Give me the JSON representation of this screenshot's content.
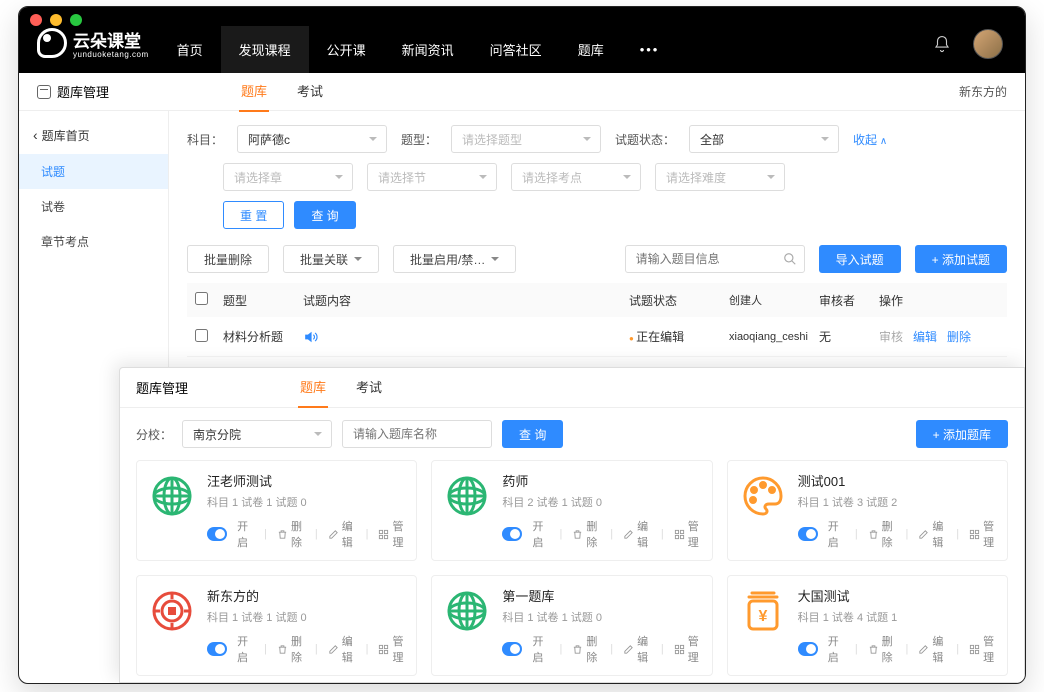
{
  "logo": {
    "name": "云朵课堂",
    "sub": "yunduoketang.com"
  },
  "nav": {
    "items": [
      "首页",
      "发现课程",
      "公开课",
      "新闻资讯",
      "问答社区",
      "题库"
    ],
    "active": 1
  },
  "crumb": "题库管理",
  "owner": "新东方的",
  "tabs": {
    "items": [
      "题库",
      "考试"
    ],
    "active": 0
  },
  "sidebar": {
    "back": "题库首页",
    "items": [
      "试题",
      "试卷",
      "章节考点"
    ],
    "active": 0
  },
  "filters": {
    "subject_label": "科目：",
    "subject_value": "阿萨德c",
    "type_label": "题型：",
    "type_placeholder": "请选择题型",
    "status_label": "试题状态：",
    "status_value": "全部",
    "collapse": "收起",
    "chapter_placeholder": "请选择章",
    "section_placeholder": "请选择节",
    "point_placeholder": "请选择考点",
    "difficulty_placeholder": "请选择难度",
    "reset": "重 置",
    "query": "查 询"
  },
  "bulk": {
    "delete": "批量删除",
    "relate": "批量关联",
    "enable": "批量启用/禁…",
    "search_placeholder": "请输入题目信息",
    "import": "导入试题",
    "add": "+ 添加试题"
  },
  "table": {
    "headers": {
      "type": "题型",
      "content": "试题内容",
      "status": "试题状态",
      "creator": "创建人",
      "reviewer": "审核者",
      "ops": "操作"
    },
    "rows": [
      {
        "type": "材料分析题",
        "content_icon": "audio",
        "status": "正在编辑",
        "creator": "xiaoqiang_ceshi",
        "reviewer": "无",
        "ops": [
          "审核",
          "编辑",
          "删除"
        ]
      }
    ]
  },
  "win2": {
    "crumb": "题库管理",
    "tabs": {
      "items": [
        "题库",
        "考试"
      ],
      "active": 0
    },
    "branch_label": "分校：",
    "branch_value": "南京分院",
    "search_placeholder": "请输入题库名称",
    "query": "查 询",
    "add": "+ 添加题库",
    "actions": {
      "open": "开启",
      "delete": "删除",
      "edit": "编辑",
      "manage": "管理"
    },
    "cards": [
      {
        "title": "汪老师测试",
        "meta": "科目 1  试卷 1  试题 0",
        "icon": "globe-green"
      },
      {
        "title": "药师",
        "meta": "科目 2  试卷 1  试题 0",
        "icon": "globe-green"
      },
      {
        "title": "测试001",
        "meta": "科目 1  试卷 3  试题 2",
        "icon": "palette-orange"
      },
      {
        "title": "新东方的",
        "meta": "科目 1  试卷 1  试题 0",
        "icon": "coin-red"
      },
      {
        "title": "第一题库",
        "meta": "科目 1  试卷 1  试题 0",
        "icon": "globe-green"
      },
      {
        "title": "大国测试",
        "meta": "科目 1  试卷 4  试题 1",
        "icon": "jar-orange"
      }
    ]
  }
}
